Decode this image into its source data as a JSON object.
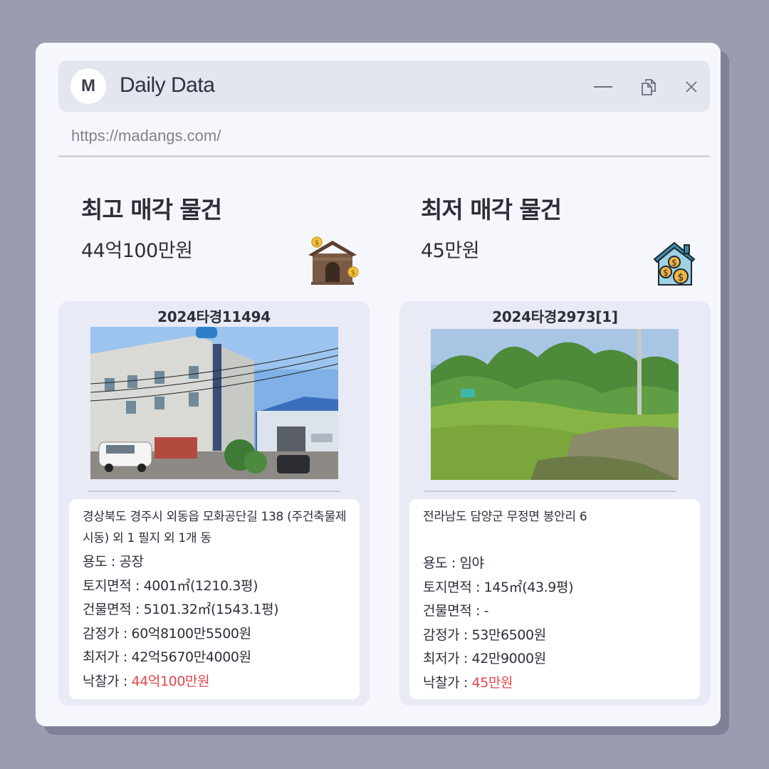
{
  "app": {
    "logo_letter": "M",
    "title": "Daily Data",
    "url": "https://madangs.com/"
  },
  "icons": {
    "minimize": "minimize-icon",
    "copy": "copy-icon",
    "close": "close-icon",
    "highest": "house-money-icon",
    "lowest": "house-coins-icon"
  },
  "highest": {
    "heading": "최고 매각 물건",
    "price": "44억100만원",
    "case_no": "2024타경11494",
    "address": "경상북도 경주시 외동읍 모화공단길 138 (주건축물제시동) 외 1 필지 외 1개 동",
    "use_label": "용도 : ",
    "use": "공장",
    "land_label": "토지면적 : ",
    "land": "4001㎡(1210.3평)",
    "building_label": "건물면적 : ",
    "building": "5101.32㎡(1543.1평)",
    "appraisal_label": "감정가 : ",
    "appraisal": "60억8100만5500원",
    "minimum_label": "최저가 : ",
    "minimum": "42억5670만4000원",
    "winning_label": "낙찰가 : ",
    "winning": "44억100만원"
  },
  "lowest": {
    "heading": "최저 매각 물건",
    "price": "45만원",
    "case_no": "2024타경2973[1]",
    "address": "전라남도 담양군 무정면 봉안리 6",
    "use_label": "용도 : ",
    "use": "임야",
    "land_label": "토지면적 : ",
    "land": "145㎡(43.9평)",
    "building_label": "건물면적 : ",
    "building": "-",
    "appraisal_label": "감정가 : ",
    "appraisal": "53만6500원",
    "minimum_label": "최저가 : ",
    "minimum": "42만9000원",
    "winning_label": "낙찰가 : ",
    "winning": "45만원"
  },
  "colors": {
    "accent_red": "#e0474c",
    "background": "#9a9cb0",
    "window": "#f6f7fc",
    "card": "#e8eaf6"
  }
}
